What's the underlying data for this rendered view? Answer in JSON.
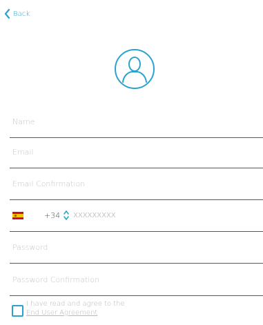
{
  "nav": {
    "back_label": "Back"
  },
  "avatar": {
    "icon": "user-avatar-icon",
    "color": "#2aa2cf"
  },
  "form": {
    "name_placeholder": "Name",
    "email_placeholder": "Email",
    "email_confirmation_placeholder": "Email Confirmation",
    "phone": {
      "country_flag": "spain-flag-icon",
      "dial_code": "+34",
      "number_placeholder": "XXXXXXXXX"
    },
    "password_placeholder": "Password",
    "password_confirmation_placeholder": "Password Confirmation"
  },
  "agreement": {
    "text": "I have read and agree to the",
    "link_label": "End User Agreement",
    "checked": false
  },
  "colors": {
    "accent": "#2aa2cf",
    "placeholder": "#c4c4c4",
    "divider": "#555555"
  }
}
